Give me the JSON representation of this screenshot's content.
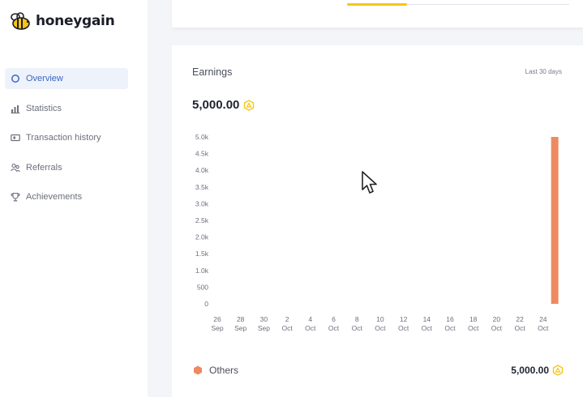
{
  "brand": {
    "name": "honeygain"
  },
  "sidebar": {
    "items": [
      {
        "label": "Overview",
        "icon": "circle-icon",
        "active": true
      },
      {
        "label": "Statistics",
        "icon": "bar-chart-icon",
        "active": false
      },
      {
        "label": "Transaction history",
        "icon": "wallet-icon",
        "active": false
      },
      {
        "label": "Referrals",
        "icon": "users-icon",
        "active": false
      },
      {
        "label": "Achievements",
        "icon": "trophy-icon",
        "active": false
      }
    ]
  },
  "earnings": {
    "title": "Earnings",
    "period": "Last 30 days",
    "total": "5,000.00"
  },
  "legend": {
    "label": "Others",
    "total": "5,000.00",
    "color": "#ee8a62"
  },
  "colors": {
    "accent": "#3b66c4",
    "bar": "#ee8a62",
    "coin": "#f5c518",
    "tab_indicator": "#f5c518"
  },
  "chart_data": {
    "type": "bar",
    "x_dates": [
      "26 Sep",
      "28 Sep",
      "30 Sep",
      "2 Oct",
      "4 Oct",
      "6 Oct",
      "8 Oct",
      "10 Oct",
      "12 Oct",
      "14 Oct",
      "16 Oct",
      "18 Oct",
      "20 Oct",
      "22 Oct",
      "24 Oct"
    ],
    "x_ticks": [
      {
        "day": "26",
        "month": "Sep"
      },
      {
        "day": "28",
        "month": "Sep"
      },
      {
        "day": "30",
        "month": "Sep"
      },
      {
        "day": "2",
        "month": "Oct"
      },
      {
        "day": "4",
        "month": "Oct"
      },
      {
        "day": "6",
        "month": "Oct"
      },
      {
        "day": "8",
        "month": "Oct"
      },
      {
        "day": "10",
        "month": "Oct"
      },
      {
        "day": "12",
        "month": "Oct"
      },
      {
        "day": "14",
        "month": "Oct"
      },
      {
        "day": "16",
        "month": "Oct"
      },
      {
        "day": "18",
        "month": "Oct"
      },
      {
        "day": "20",
        "month": "Oct"
      },
      {
        "day": "22",
        "month": "Oct"
      },
      {
        "day": "24",
        "month": "Oct"
      }
    ],
    "y_ticks": [
      "0",
      "500",
      "1.0k",
      "1.5k",
      "2.0k",
      "2.5k",
      "3.0k",
      "3.5k",
      "4.0k",
      "4.5k",
      "5.0k"
    ],
    "ylim": [
      0,
      5000
    ],
    "series": [
      {
        "name": "Others",
        "points": [
          {
            "x": "25 Oct",
            "y": 5000
          }
        ]
      }
    ],
    "grid": false,
    "legend_position": "bottom"
  }
}
